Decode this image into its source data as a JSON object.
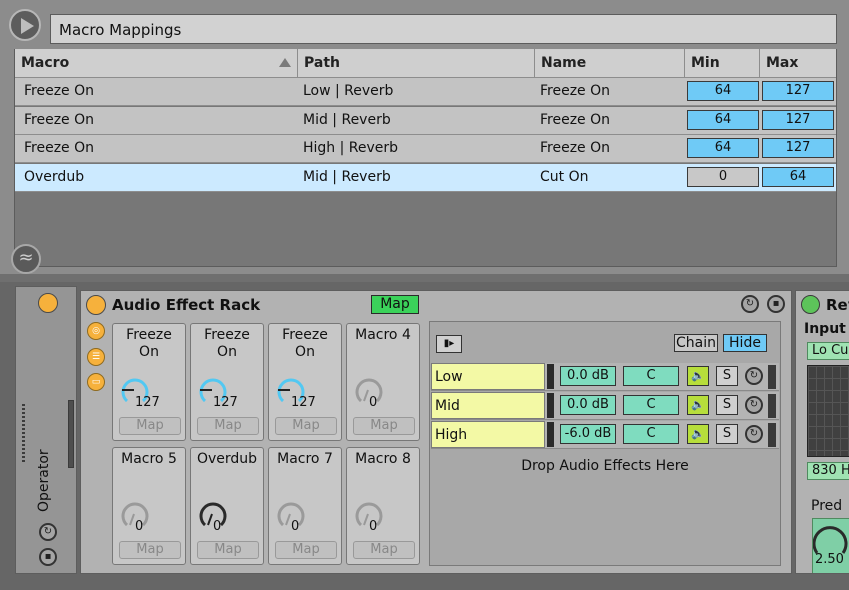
{
  "browser": {
    "title": "Macro Mappings",
    "columns": [
      "Macro",
      "Path",
      "Name",
      "Min",
      "Max"
    ],
    "rows": [
      {
        "macro": "Freeze On",
        "path": "Low | Reverb",
        "name": "Freeze On",
        "min": "64",
        "max": "127",
        "selected": false
      },
      {
        "macro": "Freeze On",
        "path": "Mid | Reverb",
        "name": "Freeze On",
        "min": "64",
        "max": "127",
        "selected": false
      },
      {
        "macro": "Freeze On",
        "path": "High | Reverb",
        "name": "Freeze On",
        "min": "64",
        "max": "127",
        "selected": false
      },
      {
        "macro": "Overdub",
        "path": "Mid | Reverb",
        "name": "Cut On",
        "min": "0",
        "max": "64",
        "selected": true
      }
    ]
  },
  "operator": {
    "label": "Operator"
  },
  "rack": {
    "title": "Audio Effect Rack",
    "map_label": "Map",
    "macros": [
      {
        "name": "Freeze\nOn",
        "value": "127",
        "active": true
      },
      {
        "name": "Freeze\nOn",
        "value": "127",
        "active": true
      },
      {
        "name": "Freeze\nOn",
        "value": "127",
        "active": true
      },
      {
        "name": "Macro 4",
        "value": "0",
        "active": false
      },
      {
        "name": "Macro 5",
        "value": "0",
        "active": false
      },
      {
        "name": "Overdub",
        "value": "0",
        "active": false,
        "dark": true
      },
      {
        "name": "Macro 7",
        "value": "0",
        "active": false
      },
      {
        "name": "Macro 8",
        "value": "0",
        "active": false
      }
    ],
    "macro_map_label": "Map",
    "chain_label": "Chain",
    "hide_label": "Hide",
    "chains": [
      {
        "name": "Low",
        "volume": "0.0 dB",
        "pan": "C"
      },
      {
        "name": "Mid",
        "volume": "0.0 dB",
        "pan": "C"
      },
      {
        "name": "High",
        "volume": "-6.0 dB",
        "pan": "C"
      }
    ],
    "solo_label": "S",
    "drop_text": "Drop Audio Effects Here"
  },
  "reverb": {
    "title": "Rev",
    "input_label": "Input",
    "lo_cut": "Lo Cu",
    "freq": "830 H",
    "predelay_label": "Pred",
    "predelay_value": "2.50"
  },
  "colors": {
    "accent_blue": "#6fcaf6",
    "map_green": "#3bd25a",
    "chain_yellow": "#f3f9a5",
    "device_orange": "#f6b13c"
  }
}
